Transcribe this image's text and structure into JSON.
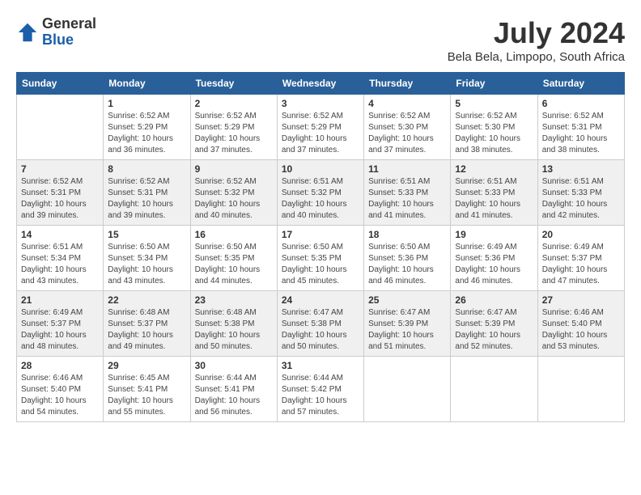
{
  "logo": {
    "general": "General",
    "blue": "Blue"
  },
  "title": {
    "month_year": "July 2024",
    "location": "Bela Bela, Limpopo, South Africa"
  },
  "headers": [
    "Sunday",
    "Monday",
    "Tuesday",
    "Wednesday",
    "Thursday",
    "Friday",
    "Saturday"
  ],
  "weeks": [
    [
      {
        "day": "",
        "info": ""
      },
      {
        "day": "1",
        "info": "Sunrise: 6:52 AM\nSunset: 5:29 PM\nDaylight: 10 hours\nand 36 minutes."
      },
      {
        "day": "2",
        "info": "Sunrise: 6:52 AM\nSunset: 5:29 PM\nDaylight: 10 hours\nand 37 minutes."
      },
      {
        "day": "3",
        "info": "Sunrise: 6:52 AM\nSunset: 5:29 PM\nDaylight: 10 hours\nand 37 minutes."
      },
      {
        "day": "4",
        "info": "Sunrise: 6:52 AM\nSunset: 5:30 PM\nDaylight: 10 hours\nand 37 minutes."
      },
      {
        "day": "5",
        "info": "Sunrise: 6:52 AM\nSunset: 5:30 PM\nDaylight: 10 hours\nand 38 minutes."
      },
      {
        "day": "6",
        "info": "Sunrise: 6:52 AM\nSunset: 5:31 PM\nDaylight: 10 hours\nand 38 minutes."
      }
    ],
    [
      {
        "day": "7",
        "info": "Sunrise: 6:52 AM\nSunset: 5:31 PM\nDaylight: 10 hours\nand 39 minutes."
      },
      {
        "day": "8",
        "info": "Sunrise: 6:52 AM\nSunset: 5:31 PM\nDaylight: 10 hours\nand 39 minutes."
      },
      {
        "day": "9",
        "info": "Sunrise: 6:52 AM\nSunset: 5:32 PM\nDaylight: 10 hours\nand 40 minutes."
      },
      {
        "day": "10",
        "info": "Sunrise: 6:51 AM\nSunset: 5:32 PM\nDaylight: 10 hours\nand 40 minutes."
      },
      {
        "day": "11",
        "info": "Sunrise: 6:51 AM\nSunset: 5:33 PM\nDaylight: 10 hours\nand 41 minutes."
      },
      {
        "day": "12",
        "info": "Sunrise: 6:51 AM\nSunset: 5:33 PM\nDaylight: 10 hours\nand 41 minutes."
      },
      {
        "day": "13",
        "info": "Sunrise: 6:51 AM\nSunset: 5:33 PM\nDaylight: 10 hours\nand 42 minutes."
      }
    ],
    [
      {
        "day": "14",
        "info": "Sunrise: 6:51 AM\nSunset: 5:34 PM\nDaylight: 10 hours\nand 43 minutes."
      },
      {
        "day": "15",
        "info": "Sunrise: 6:50 AM\nSunset: 5:34 PM\nDaylight: 10 hours\nand 43 minutes."
      },
      {
        "day": "16",
        "info": "Sunrise: 6:50 AM\nSunset: 5:35 PM\nDaylight: 10 hours\nand 44 minutes."
      },
      {
        "day": "17",
        "info": "Sunrise: 6:50 AM\nSunset: 5:35 PM\nDaylight: 10 hours\nand 45 minutes."
      },
      {
        "day": "18",
        "info": "Sunrise: 6:50 AM\nSunset: 5:36 PM\nDaylight: 10 hours\nand 46 minutes."
      },
      {
        "day": "19",
        "info": "Sunrise: 6:49 AM\nSunset: 5:36 PM\nDaylight: 10 hours\nand 46 minutes."
      },
      {
        "day": "20",
        "info": "Sunrise: 6:49 AM\nSunset: 5:37 PM\nDaylight: 10 hours\nand 47 minutes."
      }
    ],
    [
      {
        "day": "21",
        "info": "Sunrise: 6:49 AM\nSunset: 5:37 PM\nDaylight: 10 hours\nand 48 minutes."
      },
      {
        "day": "22",
        "info": "Sunrise: 6:48 AM\nSunset: 5:37 PM\nDaylight: 10 hours\nand 49 minutes."
      },
      {
        "day": "23",
        "info": "Sunrise: 6:48 AM\nSunset: 5:38 PM\nDaylight: 10 hours\nand 50 minutes."
      },
      {
        "day": "24",
        "info": "Sunrise: 6:47 AM\nSunset: 5:38 PM\nDaylight: 10 hours\nand 50 minutes."
      },
      {
        "day": "25",
        "info": "Sunrise: 6:47 AM\nSunset: 5:39 PM\nDaylight: 10 hours\nand 51 minutes."
      },
      {
        "day": "26",
        "info": "Sunrise: 6:47 AM\nSunset: 5:39 PM\nDaylight: 10 hours\nand 52 minutes."
      },
      {
        "day": "27",
        "info": "Sunrise: 6:46 AM\nSunset: 5:40 PM\nDaylight: 10 hours\nand 53 minutes."
      }
    ],
    [
      {
        "day": "28",
        "info": "Sunrise: 6:46 AM\nSunset: 5:40 PM\nDaylight: 10 hours\nand 54 minutes."
      },
      {
        "day": "29",
        "info": "Sunrise: 6:45 AM\nSunset: 5:41 PM\nDaylight: 10 hours\nand 55 minutes."
      },
      {
        "day": "30",
        "info": "Sunrise: 6:44 AM\nSunset: 5:41 PM\nDaylight: 10 hours\nand 56 minutes."
      },
      {
        "day": "31",
        "info": "Sunrise: 6:44 AM\nSunset: 5:42 PM\nDaylight: 10 hours\nand 57 minutes."
      },
      {
        "day": "",
        "info": ""
      },
      {
        "day": "",
        "info": ""
      },
      {
        "day": "",
        "info": ""
      }
    ]
  ]
}
